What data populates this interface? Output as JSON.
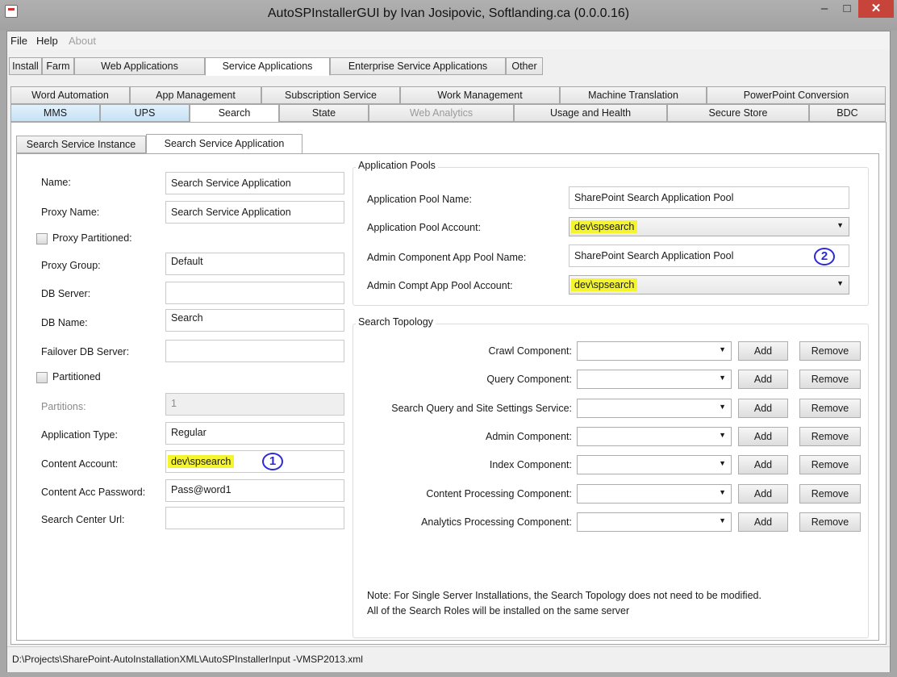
{
  "window": {
    "title": "AutoSPInstallerGUI by Ivan Josipovic, Softlanding.ca (0.0.0.16)",
    "controls": {
      "minimize": "–",
      "maximize": "□",
      "close": "✕"
    }
  },
  "menu": {
    "file": "File",
    "help": "Help",
    "about": "About"
  },
  "main_tabs": [
    "Install",
    "Farm",
    "Web Applications",
    "Service Applications",
    "Enterprise Service Applications",
    "Other"
  ],
  "service_tabs_row1": [
    "Word Automation",
    "App Management",
    "Subscription Service",
    "Work Management",
    "Machine Translation",
    "PowerPoint Conversion"
  ],
  "service_tabs_row2": [
    "MMS",
    "UPS",
    "Search",
    "State",
    "Web Analytics",
    "Usage and Health",
    "Secure Store",
    "BDC"
  ],
  "search_tabs": [
    "Search Service Instance",
    "Search Service Application"
  ],
  "form": {
    "name_label": "Name:",
    "name_value": "Search Service Application",
    "proxy_name_label": "Proxy Name:",
    "proxy_name_value": "Search Service Application",
    "proxy_partitioned_label": "Proxy Partitioned:",
    "proxy_group_label": "Proxy Group:",
    "proxy_group_value": "Default",
    "db_server_label": "DB Server:",
    "db_server_value": "",
    "db_name_label": "DB Name:",
    "db_name_value": "Search",
    "failover_label": "Failover DB Server:",
    "failover_value": "",
    "partitioned_label": "Partitioned",
    "partitions_label": "Partitions:",
    "partitions_value": "1",
    "app_type_label": "Application Type:",
    "app_type_value": "Regular",
    "content_account_label": "Content Account:",
    "content_account_value": "dev\\spsearch",
    "content_pwd_label": "Content Acc Password:",
    "content_pwd_value": "Pass@word1",
    "search_center_label": "Search Center Url:",
    "search_center_value": ""
  },
  "annotations": {
    "circle_1": "1",
    "circle_2": "2"
  },
  "app_pools": {
    "title": "Application Pools",
    "pool_name_label": "Application Pool Name:",
    "pool_name_value": "SharePoint Search Application Pool",
    "pool_account_label": "Application Pool Account:",
    "pool_account_value": "dev\\spsearch",
    "admin_pool_name_label": "Admin Component App Pool Name:",
    "admin_pool_name_value": "SharePoint Search Application Pool",
    "admin_pool_account_label": "Admin Compt App Pool Account:",
    "admin_pool_account_value": "dev\\spsearch"
  },
  "topology": {
    "title": "Search Topology",
    "components": [
      "Crawl Component:",
      "Query Component:",
      "Search Query and Site Settings Service:",
      "Admin Component:",
      "Index Component:",
      "Content Processing Component:",
      "Analytics Processing Component:"
    ],
    "add_label": "Add",
    "remove_label": "Remove",
    "note_line1": "Note: For Single Server Installations, the Search Topology does not need to be modified.",
    "note_line2": "All of the Search Roles will be installed on the same server"
  },
  "status": {
    "path": "D:\\Projects\\SharePoint-AutoInstallationXML\\AutoSPInstallerInput -VMSP2013.xml"
  },
  "colors": {
    "highlight": "#f4f430",
    "annotation_blue": "#2a2ad6",
    "close_red": "#c7443a"
  }
}
